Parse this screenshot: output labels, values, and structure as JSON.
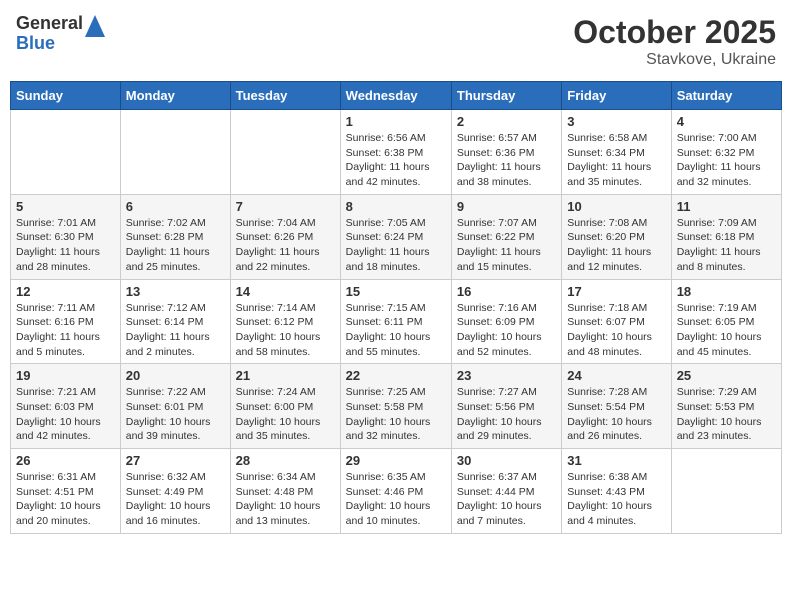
{
  "header": {
    "logo_general": "General",
    "logo_blue": "Blue",
    "title": "October 2025",
    "location": "Stavkove, Ukraine"
  },
  "days_of_week": [
    "Sunday",
    "Monday",
    "Tuesday",
    "Wednesday",
    "Thursday",
    "Friday",
    "Saturday"
  ],
  "weeks": [
    [
      {
        "day": "",
        "info": ""
      },
      {
        "day": "",
        "info": ""
      },
      {
        "day": "",
        "info": ""
      },
      {
        "day": "1",
        "info": "Sunrise: 6:56 AM\nSunset: 6:38 PM\nDaylight: 11 hours and 42 minutes."
      },
      {
        "day": "2",
        "info": "Sunrise: 6:57 AM\nSunset: 6:36 PM\nDaylight: 11 hours and 38 minutes."
      },
      {
        "day": "3",
        "info": "Sunrise: 6:58 AM\nSunset: 6:34 PM\nDaylight: 11 hours and 35 minutes."
      },
      {
        "day": "4",
        "info": "Sunrise: 7:00 AM\nSunset: 6:32 PM\nDaylight: 11 hours and 32 minutes."
      }
    ],
    [
      {
        "day": "5",
        "info": "Sunrise: 7:01 AM\nSunset: 6:30 PM\nDaylight: 11 hours and 28 minutes."
      },
      {
        "day": "6",
        "info": "Sunrise: 7:02 AM\nSunset: 6:28 PM\nDaylight: 11 hours and 25 minutes."
      },
      {
        "day": "7",
        "info": "Sunrise: 7:04 AM\nSunset: 6:26 PM\nDaylight: 11 hours and 22 minutes."
      },
      {
        "day": "8",
        "info": "Sunrise: 7:05 AM\nSunset: 6:24 PM\nDaylight: 11 hours and 18 minutes."
      },
      {
        "day": "9",
        "info": "Sunrise: 7:07 AM\nSunset: 6:22 PM\nDaylight: 11 hours and 15 minutes."
      },
      {
        "day": "10",
        "info": "Sunrise: 7:08 AM\nSunset: 6:20 PM\nDaylight: 11 hours and 12 minutes."
      },
      {
        "day": "11",
        "info": "Sunrise: 7:09 AM\nSunset: 6:18 PM\nDaylight: 11 hours and 8 minutes."
      }
    ],
    [
      {
        "day": "12",
        "info": "Sunrise: 7:11 AM\nSunset: 6:16 PM\nDaylight: 11 hours and 5 minutes."
      },
      {
        "day": "13",
        "info": "Sunrise: 7:12 AM\nSunset: 6:14 PM\nDaylight: 11 hours and 2 minutes."
      },
      {
        "day": "14",
        "info": "Sunrise: 7:14 AM\nSunset: 6:12 PM\nDaylight: 10 hours and 58 minutes."
      },
      {
        "day": "15",
        "info": "Sunrise: 7:15 AM\nSunset: 6:11 PM\nDaylight: 10 hours and 55 minutes."
      },
      {
        "day": "16",
        "info": "Sunrise: 7:16 AM\nSunset: 6:09 PM\nDaylight: 10 hours and 52 minutes."
      },
      {
        "day": "17",
        "info": "Sunrise: 7:18 AM\nSunset: 6:07 PM\nDaylight: 10 hours and 48 minutes."
      },
      {
        "day": "18",
        "info": "Sunrise: 7:19 AM\nSunset: 6:05 PM\nDaylight: 10 hours and 45 minutes."
      }
    ],
    [
      {
        "day": "19",
        "info": "Sunrise: 7:21 AM\nSunset: 6:03 PM\nDaylight: 10 hours and 42 minutes."
      },
      {
        "day": "20",
        "info": "Sunrise: 7:22 AM\nSunset: 6:01 PM\nDaylight: 10 hours and 39 minutes."
      },
      {
        "day": "21",
        "info": "Sunrise: 7:24 AM\nSunset: 6:00 PM\nDaylight: 10 hours and 35 minutes."
      },
      {
        "day": "22",
        "info": "Sunrise: 7:25 AM\nSunset: 5:58 PM\nDaylight: 10 hours and 32 minutes."
      },
      {
        "day": "23",
        "info": "Sunrise: 7:27 AM\nSunset: 5:56 PM\nDaylight: 10 hours and 29 minutes."
      },
      {
        "day": "24",
        "info": "Sunrise: 7:28 AM\nSunset: 5:54 PM\nDaylight: 10 hours and 26 minutes."
      },
      {
        "day": "25",
        "info": "Sunrise: 7:29 AM\nSunset: 5:53 PM\nDaylight: 10 hours and 23 minutes."
      }
    ],
    [
      {
        "day": "26",
        "info": "Sunrise: 6:31 AM\nSunset: 4:51 PM\nDaylight: 10 hours and 20 minutes."
      },
      {
        "day": "27",
        "info": "Sunrise: 6:32 AM\nSunset: 4:49 PM\nDaylight: 10 hours and 16 minutes."
      },
      {
        "day": "28",
        "info": "Sunrise: 6:34 AM\nSunset: 4:48 PM\nDaylight: 10 hours and 13 minutes."
      },
      {
        "day": "29",
        "info": "Sunrise: 6:35 AM\nSunset: 4:46 PM\nDaylight: 10 hours and 10 minutes."
      },
      {
        "day": "30",
        "info": "Sunrise: 6:37 AM\nSunset: 4:44 PM\nDaylight: 10 hours and 7 minutes."
      },
      {
        "day": "31",
        "info": "Sunrise: 6:38 AM\nSunset: 4:43 PM\nDaylight: 10 hours and 4 minutes."
      },
      {
        "day": "",
        "info": ""
      }
    ]
  ]
}
